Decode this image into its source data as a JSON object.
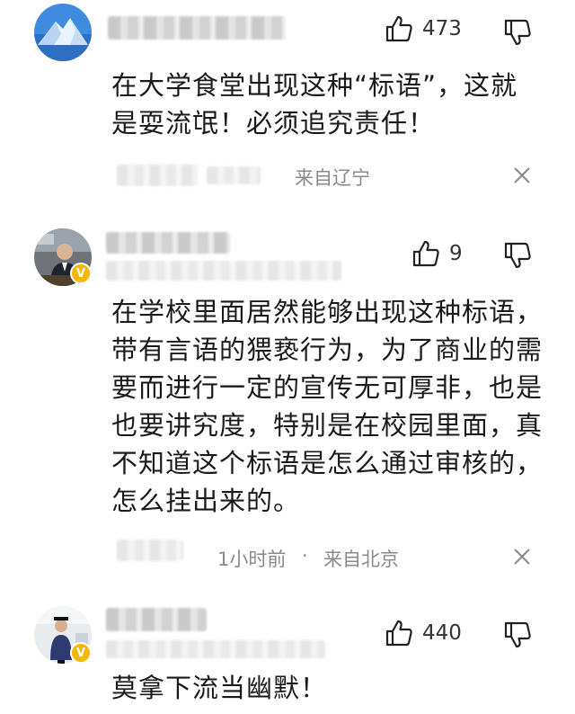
{
  "comments": [
    {
      "likes": "473",
      "text": "在大学食堂出现这种“标语”，这就是耍流氓！必须追究责任！",
      "time": "",
      "location": "来自辽宁",
      "verified": false
    },
    {
      "likes": "9",
      "text": "在学校里面居然能够出现这种标语，带有言语的猥亵行为，为了商业的需要而进行一定的宣传无可厚非，也是也要讲究度，特别是在校园里面，真不知道这个标语是怎么通过审核的，怎么挂出来的。",
      "time": "1小时前",
      "separator": "·",
      "location": "来自北京",
      "verified": true
    },
    {
      "likes": "440",
      "text": "莫拿下流当幽默！",
      "verified": true
    }
  ],
  "icons": {
    "like": "thumbs-up-icon",
    "dislike": "thumbs-down-icon",
    "close": "close-icon",
    "verified": "verified-badge-icon",
    "badge_letter": "V"
  },
  "colors": {
    "badge": "#f5b800",
    "meta": "#8a8a8a",
    "text": "#1a1a1a"
  }
}
